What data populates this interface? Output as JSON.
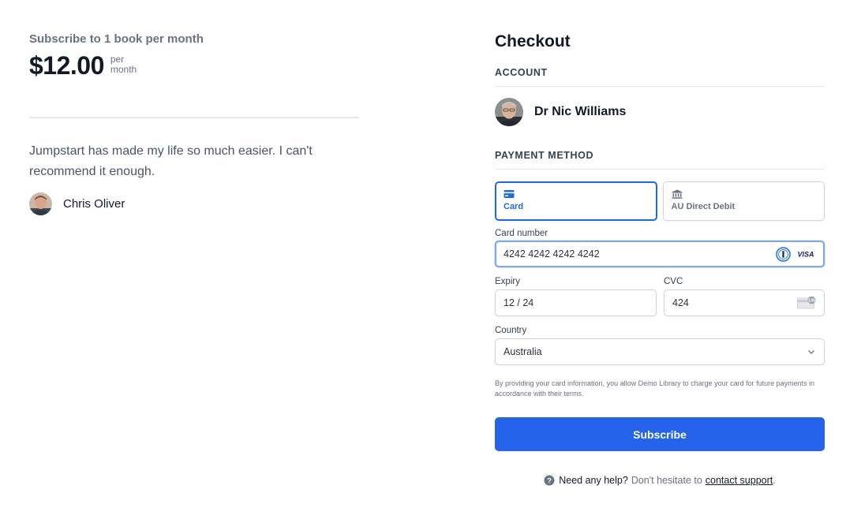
{
  "plan": {
    "title": "Subscribe to 1 book per month",
    "price": "$12.00",
    "per_line1": "per",
    "per_line2": "month"
  },
  "testimonial": {
    "quote": "Jumpstart has made my life so much easier. I can't recommend it enough.",
    "author": "Chris Oliver"
  },
  "checkout": {
    "title": "Checkout",
    "account_label": "ACCOUNT",
    "account_name": "Dr Nic Williams",
    "payment_label": "PAYMENT METHOD",
    "tabs": [
      {
        "label": "Card",
        "icon": "card-icon",
        "active": true
      },
      {
        "label": "AU Direct Debit",
        "icon": "bank-icon",
        "active": false
      }
    ],
    "card_number_label": "Card number",
    "card_number_value": "4242 4242 4242 4242",
    "card_brand": "VISA",
    "expiry_label": "Expiry",
    "expiry_value": "12 / 24",
    "cvc_label": "CVC",
    "cvc_value": "424",
    "cvc_icon_text": "135",
    "country_label": "Country",
    "country_value": "Australia",
    "legal": "By providing your card information, you allow Demo Library to charge your card for future payments in accordance with their terms.",
    "subscribe_label": "Subscribe"
  },
  "help": {
    "strong": "Need any help?",
    "text": "Don't hesitate to",
    "link": "contact support",
    "period": "."
  },
  "colors": {
    "accent": "#2563eb",
    "active_tab": "#1d6ae5"
  }
}
